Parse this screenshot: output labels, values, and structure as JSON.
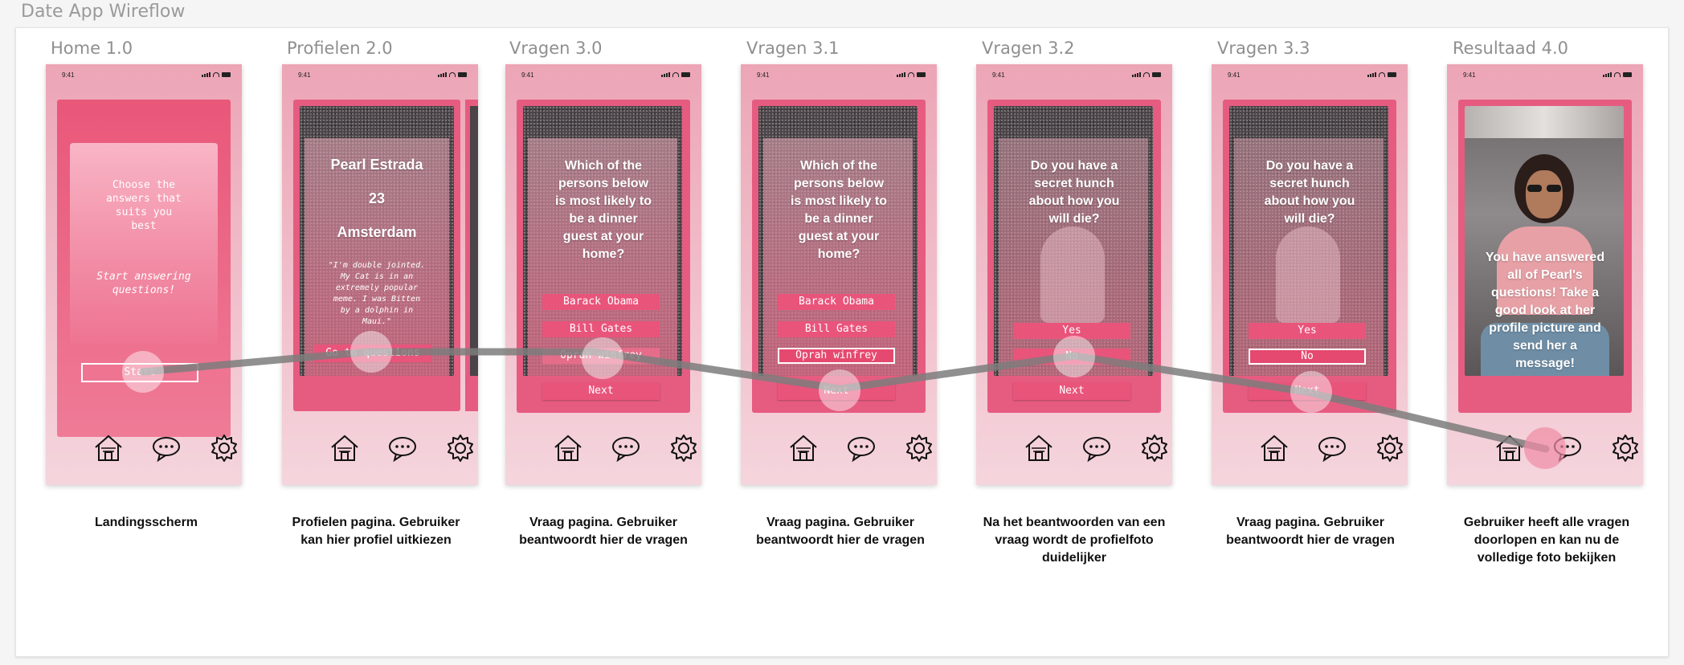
{
  "board": {
    "title": "Date App Wireflow"
  },
  "status_time": "9:41",
  "nav_icons": [
    "home-icon",
    "chat-icon",
    "gear-icon"
  ],
  "colors": {
    "accent": "#e65c80",
    "button": "#e9547b",
    "phone_bg": "#eca5b6"
  },
  "screens": {
    "home": {
      "label": "Home 1.0",
      "line1": "Choose the",
      "line2": "answers that",
      "line3": "suits you",
      "line4": "best",
      "line5": "Start answering",
      "line6": "questions!",
      "button": "Start",
      "caption": "Landingsscherm"
    },
    "profiles": {
      "label": "Profielen 2.0",
      "name": "Pearl Estrada",
      "age": "23",
      "city": "Amsterdam",
      "quote1": "\"I'm double jointed.",
      "quote2": "My Cat is in an",
      "quote3": "extremely popular",
      "quote4": "meme. I was Bitten",
      "quote5": "by a dolphin in",
      "quote6": "Maui.\"",
      "button": "Go to questions",
      "caption1": "Profielen pagina. Gebruiker",
      "caption2": "kan hier profiel uitkiezen"
    },
    "q30": {
      "label": "Vragen 3.0",
      "line1": "Which of the",
      "line2": "persons below",
      "line3": "is most likely to",
      "line4": "be a dinner",
      "line5": "guest at your",
      "line6": "home?",
      "opt1": "Barack Obama",
      "opt2": "Bill Gates",
      "opt3": "Oprah winfrey",
      "next": "Next",
      "caption1": "Vraag pagina. Gebruiker",
      "caption2": "beantwoordt  hier de vragen"
    },
    "q31": {
      "label": "Vragen 3.1",
      "line1": "Which of the",
      "line2": "persons below",
      "line3": "is most likely to",
      "line4": "be a dinner",
      "line5": "guest at your",
      "line6": "home?",
      "opt1": "Barack Obama",
      "opt2": "Bill Gates",
      "opt3": "Oprah winfrey",
      "next": "Next",
      "caption1": "Vraag pagina. Gebruiker",
      "caption2": "beantwoordt  hier de vragen"
    },
    "q32": {
      "label": "Vragen 3.2",
      "line1": "Do you have a",
      "line2": "secret hunch",
      "line3": "about how you",
      "line4": "will die?",
      "opt1": "Yes",
      "opt2": "No",
      "next": "Next",
      "caption1": "Na het beantwoorden van een",
      "caption2": "vraag wordt de profielfoto",
      "caption3": "duidelijker"
    },
    "q33": {
      "label": "Vragen 3.3",
      "line1": "Do you have a",
      "line2": "secret hunch",
      "line3": "about how you",
      "line4": "will die?",
      "opt1": "Yes",
      "opt2": "No",
      "next": "Next",
      "caption1": "Vraag pagina. Gebruiker",
      "caption2": "beantwoordt  hier de vragen"
    },
    "result": {
      "label": "Resultaad 4.0",
      "line1": "You have answered",
      "line2": "all of Pearl's",
      "line3": "questions! Take a",
      "line4": "good look at her",
      "line5": "profile picture and",
      "line6": "send her a",
      "line7": "message!",
      "caption1": "Gebruiker heeft alle vragen",
      "caption2": "doorlopen en kan nu de",
      "caption3": "volledige foto bekijken"
    }
  }
}
